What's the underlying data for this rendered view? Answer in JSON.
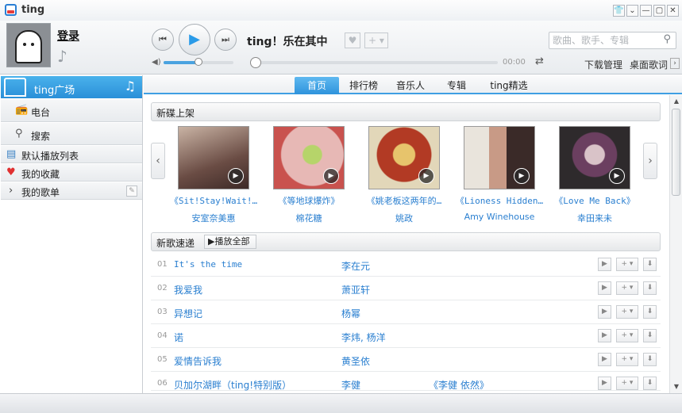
{
  "app": {
    "title": "ting"
  },
  "window_buttons": [
    "👕",
    "⌄",
    "—",
    "▢",
    "✕"
  ],
  "user": {
    "login_label": "登录"
  },
  "player": {
    "song_title": "ting！乐在其中",
    "time": "00:00",
    "volume_percent": 50,
    "progress_percent": 0,
    "search_placeholder": "歌曲、歌手、专辑",
    "download_manager": "下载管理",
    "desktop_lyrics": "桌面歌词"
  },
  "sidebar": {
    "header_label": "ting广场",
    "items": [
      {
        "label": "电台",
        "icon": "radio-icon"
      },
      {
        "label": "搜索",
        "icon": "search-icon"
      },
      {
        "label": "默认播放列表",
        "icon": "playlist-icon"
      },
      {
        "label": "我的收藏",
        "icon": "heart-icon"
      },
      {
        "label": "我的歌单",
        "icon": "chevron-right-icon"
      }
    ]
  },
  "tabs": [
    {
      "label": "首页",
      "active": true
    },
    {
      "label": "排行榜",
      "active": false
    },
    {
      "label": "音乐人",
      "active": false
    },
    {
      "label": "专辑",
      "active": false
    },
    {
      "label": "ting精选",
      "active": false
    }
  ],
  "new_albums": {
    "title": "新碟上架",
    "albums": [
      {
        "title": "《Sit!Stay!Wait!…",
        "artist": "安室奈美惠",
        "cover_color": "#8a6a5e"
      },
      {
        "title": "《等地球爆炸》",
        "artist": "棉花糖",
        "cover_color": "#d9a4a0"
      },
      {
        "title": "《姚老板这两年的…",
        "artist": "姚政",
        "cover_color": "#a5402c"
      },
      {
        "title": "《Lioness Hidden…",
        "artist": "Amy Winehouse",
        "cover_color": "#b7a89a"
      },
      {
        "title": "《Love Me Back》",
        "artist": "幸田来未",
        "cover_color": "#5a4a52"
      }
    ]
  },
  "new_songs": {
    "title": "新歌速递",
    "play_all_label": "播放全部",
    "tracks": [
      {
        "num": "01",
        "name": "It's the time",
        "artist": "李在元",
        "album": "",
        "mono": true
      },
      {
        "num": "02",
        "name": "我爱我",
        "artist": "萧亚轩",
        "album": "",
        "mono": false
      },
      {
        "num": "03",
        "name": "异想记",
        "artist": "杨幂",
        "album": "",
        "mono": false
      },
      {
        "num": "04",
        "name": "诺",
        "artist": "李炜, 杨洋",
        "album": "",
        "mono": false
      },
      {
        "num": "05",
        "name": "爱情告诉我",
        "artist": "黄圣依",
        "album": "",
        "mono": false
      },
      {
        "num": "06",
        "name": "贝加尔湖畔（ting!特别版）",
        "artist": "李健",
        "album": "《李健 依然》",
        "mono": false
      }
    ]
  },
  "colors": {
    "accent": "#2e93dc",
    "link": "#2a7fd0"
  }
}
